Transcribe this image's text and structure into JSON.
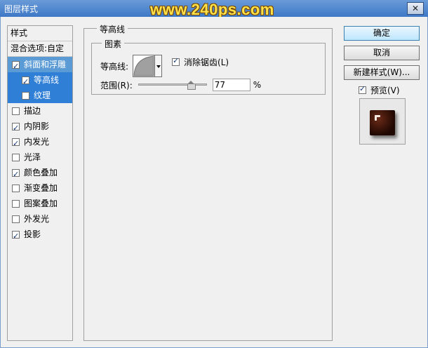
{
  "window": {
    "title": "图层样式",
    "watermark": "www.240ps.com",
    "close_glyph": "✕"
  },
  "stylelist": {
    "header": "样式",
    "blend_options": "混合选项:自定",
    "items": [
      {
        "label": "斜面和浮雕",
        "checked": true,
        "selected": true
      },
      {
        "label": "等高线",
        "checked": true,
        "selected": true,
        "sub": true
      },
      {
        "label": "纹理",
        "checked": false,
        "selected": true,
        "sub": true
      },
      {
        "label": "描边",
        "checked": false
      },
      {
        "label": "内阴影",
        "checked": true
      },
      {
        "label": "内发光",
        "checked": true
      },
      {
        "label": "光泽",
        "checked": false
      },
      {
        "label": "颜色叠加",
        "checked": true
      },
      {
        "label": "渐变叠加",
        "checked": false
      },
      {
        "label": "图案叠加",
        "checked": false
      },
      {
        "label": "外发光",
        "checked": false
      },
      {
        "label": "投影",
        "checked": true
      }
    ]
  },
  "panel": {
    "title": "等高线",
    "group_title": "图素",
    "contour_label": "等高线:",
    "antialias_label": "消除锯齿(L)",
    "antialias_checked": true,
    "range_label": "范围(R):",
    "range_value": "77",
    "range_unit": "%"
  },
  "buttons": {
    "ok": "确定",
    "cancel": "取消",
    "new_style": "新建样式(W)..."
  },
  "preview": {
    "label": "预览(V)",
    "checked": true
  }
}
